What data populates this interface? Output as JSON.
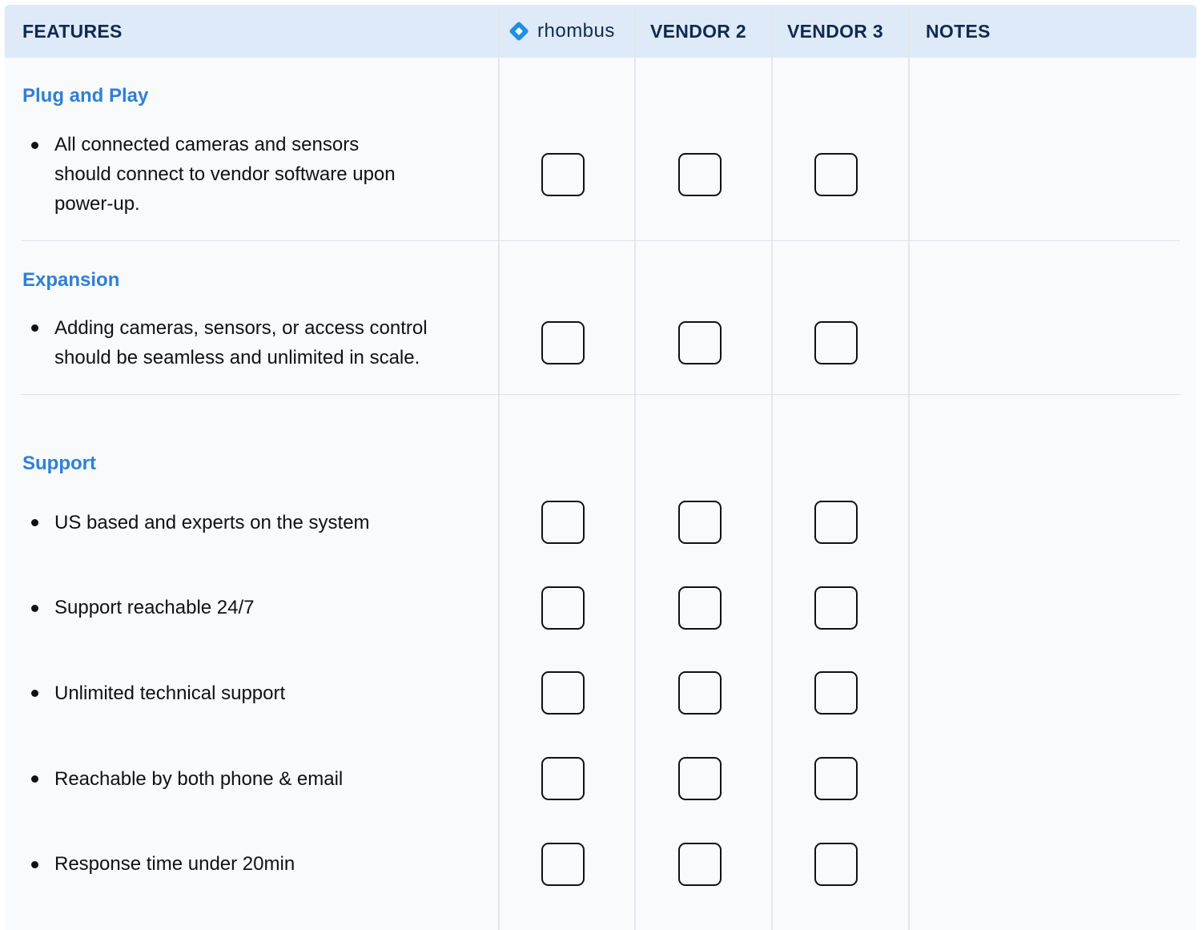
{
  "header": {
    "features": "FEATURES",
    "brand": "rhombus",
    "brand_logo_icon": "rhombus-logo-icon",
    "vendor2": "VENDOR 2",
    "vendor3": "VENDOR 3",
    "notes": "NOTES"
  },
  "colors": {
    "header_bg": "#deeaf7",
    "section_title": "#2f7fd6",
    "header_text": "#0f2a52",
    "logo": "#1e8fe8"
  },
  "sections": [
    {
      "title": "Plug and Play",
      "items": [
        {
          "lines": [
            "All connected cameras and sensors",
            "should connect to vendor software upon",
            "power-up."
          ],
          "checked": [
            false,
            false,
            false
          ]
        }
      ]
    },
    {
      "title": "Expansion",
      "items": [
        {
          "lines": [
            "Adding cameras, sensors, or access control",
            "should be seamless and unlimited in scale."
          ],
          "checked": [
            false,
            false,
            false
          ]
        }
      ]
    },
    {
      "title": "Support",
      "items": [
        {
          "lines": [
            "US based and experts on the system"
          ],
          "checked": [
            false,
            false,
            false
          ]
        },
        {
          "lines": [
            "Support reachable 24/7"
          ],
          "checked": [
            false,
            false,
            false
          ]
        },
        {
          "lines": [
            "Unlimited technical support"
          ],
          "checked": [
            false,
            false,
            false
          ]
        },
        {
          "lines": [
            "Reachable by both phone & email"
          ],
          "checked": [
            false,
            false,
            false
          ]
        },
        {
          "lines": [
            "Response time under 20min"
          ],
          "checked": [
            false,
            false,
            false
          ]
        }
      ]
    }
  ]
}
